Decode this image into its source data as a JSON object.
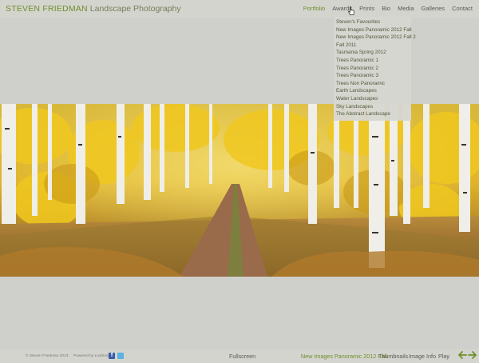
{
  "header": {
    "brand_name": "STEVEN FRIEDMAN",
    "brand_sub": "Landscape Photography"
  },
  "nav": {
    "items": [
      "Portfolio",
      "Awards",
      "Prints",
      "Bio",
      "Media",
      "Galleries",
      "Contact"
    ],
    "active": "Portfolio"
  },
  "dropdown": {
    "items": [
      "Steven's Favourites",
      "New Images Panoramic 2012 Fall",
      "New Images Panoramic 2012 Fall 2",
      "Fall 2011",
      "Tasmania Spring 2012",
      "Trees Panoramic 1",
      "Trees Panoramic 2",
      "Trees Panoramic 3",
      "Trees Non Panoramic",
      "Earth Landscapes",
      "Water Landscapes",
      "Sky Landscapes",
      "The Abstract Landscape"
    ]
  },
  "footer": {
    "copyright": "© Steven Friedman 2013",
    "powered": "Powered by Livebooks",
    "fb_letter": "f",
    "fullscreen": "Fullscreen",
    "album": "New Images Panoramic 2012 Fall",
    "thumbnails": "Thumbnails",
    "image_info": "Image Info",
    "play": "Play"
  },
  "colors": {
    "accent": "#6f8f2a",
    "background": "#cfcfcb",
    "bar": "#d4d4cf"
  },
  "icons": {
    "cursor": "hand-pointer-icon",
    "facebook": "facebook-icon",
    "twitter": "twitter-icon",
    "prev": "arrow-left-icon",
    "next": "arrow-right-icon"
  }
}
